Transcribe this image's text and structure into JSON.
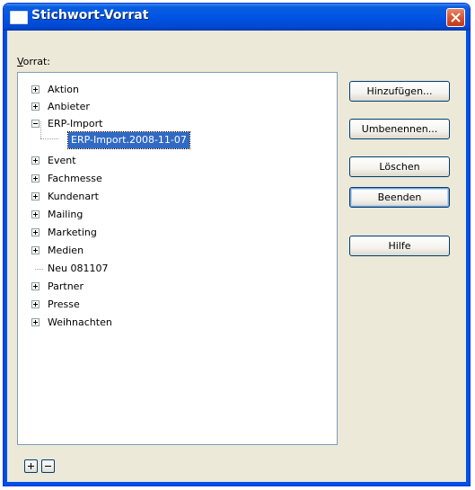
{
  "window": {
    "title": "Stichwort-Vorrat"
  },
  "label": {
    "vorrat_first": "V",
    "vorrat_rest": "orrat:"
  },
  "tree": {
    "items": [
      {
        "label": "Aktion",
        "expander": "plus"
      },
      {
        "label": "Anbieter",
        "expander": "plus"
      },
      {
        "label": "ERP-Import",
        "expander": "minus",
        "children": [
          {
            "label": "ERP-Import.2008-11-07",
            "selected": true
          }
        ]
      },
      {
        "label": "Event",
        "expander": "plus"
      },
      {
        "label": "Fachmesse",
        "expander": "plus"
      },
      {
        "label": "Kundenart",
        "expander": "plus"
      },
      {
        "label": "Mailing",
        "expander": "plus"
      },
      {
        "label": "Marketing",
        "expander": "plus"
      },
      {
        "label": "Medien",
        "expander": "plus"
      },
      {
        "label": "Neu 081107",
        "expander": "none"
      },
      {
        "label": "Partner",
        "expander": "plus"
      },
      {
        "label": "Presse",
        "expander": "plus"
      },
      {
        "label": "Weihnachten",
        "expander": "plus"
      }
    ]
  },
  "buttons": {
    "add": "Hinzufügen...",
    "rename": "Umbenennen...",
    "delete": "Löschen",
    "close": "Beenden",
    "help": "Hilfe"
  },
  "icons": {
    "close": "close-icon",
    "expand": "plus-icon",
    "collapse": "minus-icon"
  },
  "colors": {
    "titlebar": "#0054e3",
    "selection": "#316ac5",
    "close_button": "#d6512f"
  }
}
